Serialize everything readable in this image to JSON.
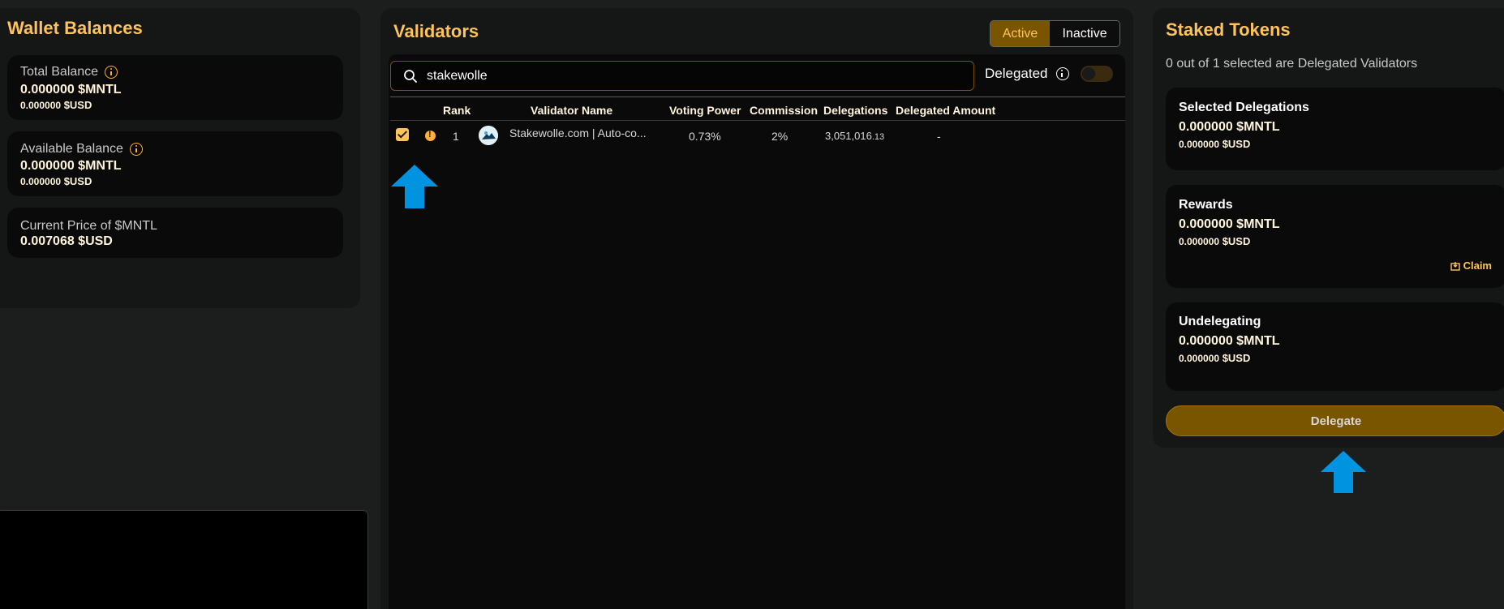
{
  "wallet": {
    "title": "Wallet Balances",
    "total": {
      "label": "Total Balance",
      "mntl": "0.000000 $MNTL",
      "usd_num": "0.000000",
      "usd_unit": "$USD"
    },
    "available": {
      "label": "Available Balance",
      "mntl": "0.000000 $MNTL",
      "usd_num": "0.000000",
      "usd_unit": "$USD"
    },
    "price": {
      "label": "Current Price of $MNTL",
      "value": "0.007068 $USD"
    }
  },
  "validators": {
    "title": "Validators",
    "tabs": {
      "active": "Active",
      "inactive": "Inactive"
    },
    "search": {
      "value": "stakewolle"
    },
    "delegated_filter": {
      "label": "Delegated",
      "on": false
    },
    "columns": [
      "Rank",
      "Validator Name",
      "Voting Power",
      "Commission",
      "Delegations",
      "Delegated Amount"
    ],
    "rows": [
      {
        "selected": true,
        "rank": "1",
        "name": "Stakewolle.com | Auto-co...",
        "voting_power": "0.73%",
        "commission": "2%",
        "delegations_main": "3,051,016",
        "delegations_decimal": ".13",
        "delegated_amount": "-"
      }
    ]
  },
  "staked": {
    "title": "Staked Tokens",
    "selected_info": "0 out of 1 selected are Delegated Validators",
    "selected_delegations": {
      "label": "Selected Delegations",
      "mntl": "0.000000 $MNTL",
      "usd_num": "0.000000",
      "usd_unit": "$USD"
    },
    "rewards": {
      "label": "Rewards",
      "mntl": "0.000000 $MNTL",
      "usd_num": "0.000000",
      "usd_unit": "$USD",
      "claim": "Claim"
    },
    "undelegating": {
      "label": "Undelegating",
      "mntl": "0.000000 $MNTL",
      "usd_num": "0.000000",
      "usd_unit": "$USD"
    },
    "delegate_button": "Delegate"
  },
  "colors": {
    "accent": "#ffc35a",
    "panel_bg": "#151616",
    "card_bg": "#0a0a0a",
    "button_bg": "#7a5500",
    "annotation_arrow": "#0094e0"
  },
  "icons": [
    "info-icon",
    "search-icon",
    "warning-icon",
    "checkbox-checked-icon",
    "claim-icon",
    "annotation-arrow-icon"
  ]
}
